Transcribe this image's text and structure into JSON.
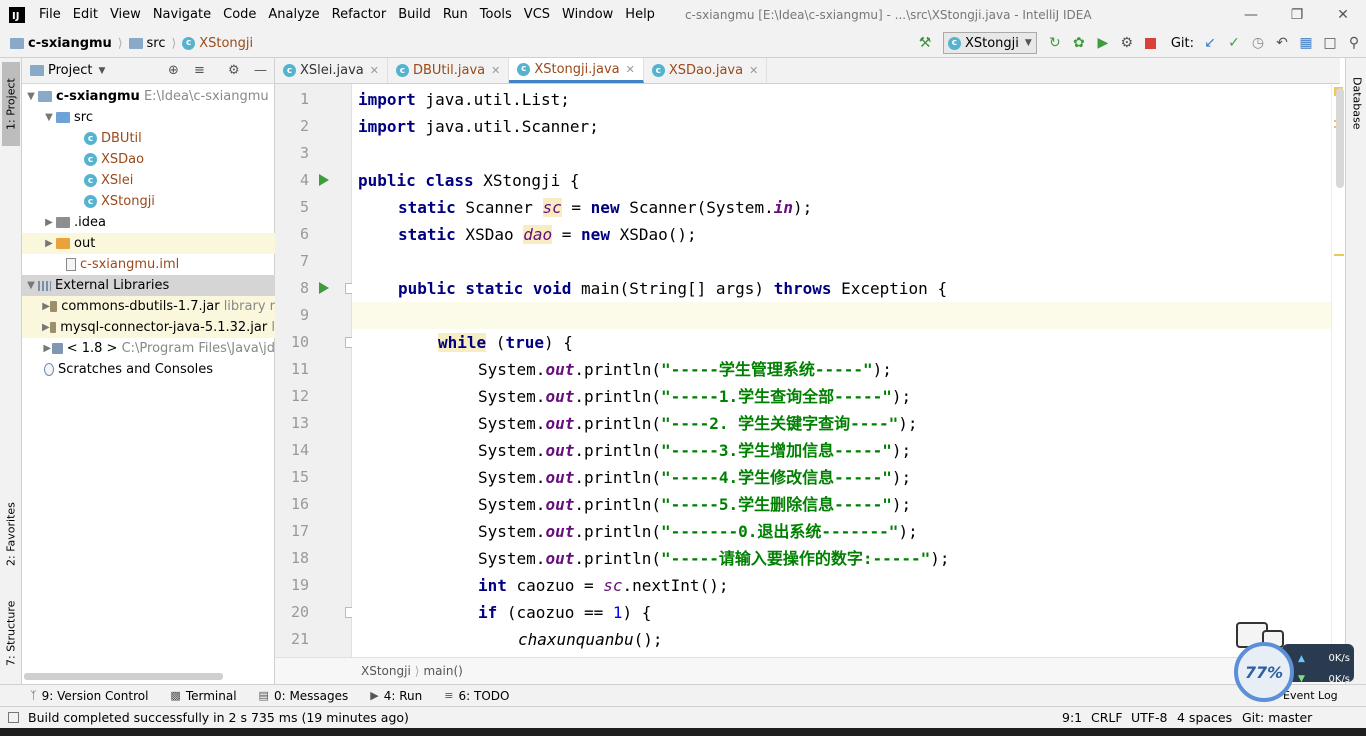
{
  "menubar": {
    "items": [
      "File",
      "Edit",
      "View",
      "Navigate",
      "Code",
      "Analyze",
      "Refactor",
      "Build",
      "Run",
      "Tools",
      "VCS",
      "Window",
      "Help"
    ],
    "window_title": "c-sxiangmu [E:\\Idea\\c-sxiangmu] - ...\\src\\XStongji.java - IntelliJ IDEA"
  },
  "navbar": {
    "project": "c-sxiangmu",
    "folder": "src",
    "file": "XStongji",
    "run_config": "XStongji",
    "git_label": "Git:"
  },
  "project_panel": {
    "title": "Project",
    "root_name": "c-sxiangmu",
    "root_path": "E:\\Idea\\c-sxiangmu",
    "src": "src",
    "classes": [
      "DBUtil",
      "XSDao",
      "XSlei",
      "XStongji"
    ],
    "idea": ".idea",
    "out": "out",
    "iml": "c-sxiangmu.iml",
    "ext_libs": "External Libraries",
    "lib1": "commons-dbutils-1.7.jar",
    "lib1_suffix": "library r",
    "lib2": "mysql-connector-java-5.1.32.jar",
    "lib2_suffix": "l",
    "jdk": "< 1.8 >",
    "jdk_path": "C:\\Program Files\\Java\\jd",
    "scratches": "Scratches and Consoles"
  },
  "left_strip": {
    "project_tab": "1: Project",
    "favorites_tab": "2: Favorites",
    "structure_tab": "7: Structure"
  },
  "right_strip": {
    "database_tab": "Database"
  },
  "tabs": [
    {
      "label": "XSlei.java",
      "active": false
    },
    {
      "label": "DBUtil.java",
      "active": false
    },
    {
      "label": "XStongji.java",
      "active": true
    },
    {
      "label": "XSDao.java",
      "active": false
    }
  ],
  "code": {
    "line_numbers": [
      "1",
      "2",
      "3",
      "4",
      "5",
      "6",
      "7",
      "8",
      "9",
      "10",
      "11",
      "12",
      "13",
      "14",
      "15",
      "16",
      "17",
      "18",
      "19",
      "20",
      "21"
    ],
    "l1_kw": "import",
    "l1_rest": " java.util.List;",
    "l2_kw": "import",
    "l2_rest": " java.util.Scanner;",
    "l4_kw": "public class",
    "l4_rest": " XStongji {",
    "l5_kw1": "static",
    "l5_a": " Scanner ",
    "l5_sc": "sc",
    "l5_b": " = ",
    "l5_kw2": "new",
    "l5_c": " Scanner(System.",
    "l5_in": "in",
    "l5_d": ");",
    "l6_kw1": "static",
    "l6_a": " XSDao ",
    "l6_dao": "dao",
    "l6_b": " = ",
    "l6_kw2": "new",
    "l6_c": " XSDao();",
    "l8_kw": "public static void",
    "l8_a": " main(String[] args) ",
    "l8_throws": "throws",
    "l8_b": " Exception {",
    "l10_kw1": "while",
    "l10_a": " (",
    "l10_kw2": "true",
    "l10_b": ") {",
    "sys": "System.",
    "out": "out",
    "println": ".println(",
    "close": ");",
    "s11": "\"-----学生管理系统-----\"",
    "s12": "\"-----1.学生查询全部-----\"",
    "s13": "\"----2. 学生关键字查询----\"",
    "s14": "\"-----3.学生增加信息-----\"",
    "s15": "\"-----4.学生修改信息-----\"",
    "s16": "\"-----5.学生删除信息-----\"",
    "s17": "\"-------0.退出系统-------\"",
    "s18": "\"-----请输入要操作的数字:-----\"",
    "l19_kw": "int",
    "l19_a": " caozuo = ",
    "l19_sc": "sc",
    "l19_b": ".nextInt();",
    "l20_kw": "if",
    "l20_a": " (caozuo == ",
    "l20_num": "1",
    "l20_b": ") {",
    "l21": "chaxunquanbu",
    "l21_b": "();"
  },
  "breadcrumb_bottom": {
    "cls": "XStongji",
    "method": "main()"
  },
  "bottom_tools": [
    {
      "label": "9: Version Control"
    },
    {
      "label": "Terminal"
    },
    {
      "label": "0: Messages"
    },
    {
      "label": "4: Run"
    },
    {
      "label": "6: TODO"
    }
  ],
  "event_log": "Event Log",
  "status": {
    "message": "Build completed successfully in 2 s 735 ms (19 minutes ago)",
    "position": "9:1",
    "line_sep": "CRLF",
    "encoding": "UTF-8",
    "indent": "4 spaces",
    "git": "Git: master"
  },
  "net_widget": {
    "percent": "77%",
    "up": "0K/s",
    "down": "0K/s"
  }
}
